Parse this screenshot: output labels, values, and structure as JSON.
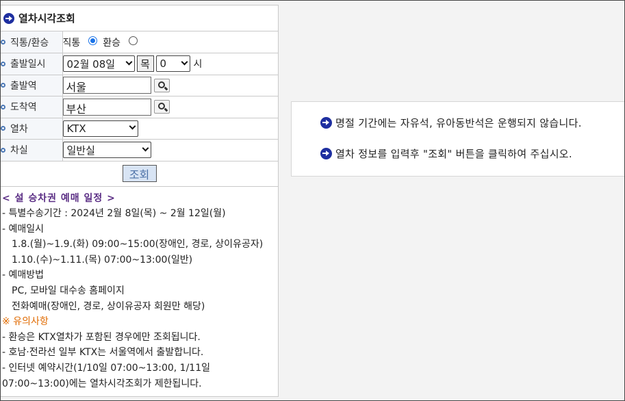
{
  "panel": {
    "title": "열차시각조회"
  },
  "form": {
    "route_type": {
      "label": "직통/환승",
      "options": [
        {
          "label": "직통",
          "checked": true
        },
        {
          "label": "환승",
          "checked": false
        }
      ]
    },
    "departure": {
      "label": "출발일시",
      "date": "02월 08일",
      "weekday": "목",
      "hour": "0",
      "hour_unit": "시"
    },
    "origin": {
      "label": "출발역",
      "value": "서울"
    },
    "destination": {
      "label": "도착역",
      "value": "부산"
    },
    "train": {
      "label": "열차",
      "value": "KTX"
    },
    "car_class": {
      "label": "차실",
      "value": "일반실"
    },
    "submit_label": "조회"
  },
  "notice": {
    "heading": "< 설 승차권 예매 일정 >",
    "lines": [
      "- 특별수송기간 : 2024년 2월 8일(목) ~ 2월 12일(월)",
      "- 예매일시",
      "1.8.(월)~1.9.(화) 09:00~15:00(장애인, 경로, 상이유공자)",
      "1.10.(수)~1.11.(목) 07:00~13:00(일반)",
      "- 예매방법",
      "PC, 모바일 대수송 홈페이지",
      "전화예매(장애인, 경로, 상이유공자 회원만 해당)"
    ],
    "warning_title": "※ 유의사항",
    "warning_lines": [
      "- 환승은 KTX열차가 포함된 경우에만 조회됩니다.",
      "- 호남·전라선 일부 KTX는 서울역에서 출발합니다.",
      "- 인터넷 예약시간(1/10일 07:00~13:00, 1/11일",
      "07:00~13:00)에는 열차시각조회가 제한됩니다."
    ]
  },
  "messages": [
    "명절 기간에는 자유석, 유아동반석은 운행되지 않습니다.",
    "열차 정보를 입력후 \"조회\" 버튼을 클릭하여 주십시오."
  ],
  "colors": {
    "accent": "#1e2fa0",
    "heading": "#5a2d84",
    "warning": "#e06a00",
    "submit_bg": "#d8e4f4"
  }
}
